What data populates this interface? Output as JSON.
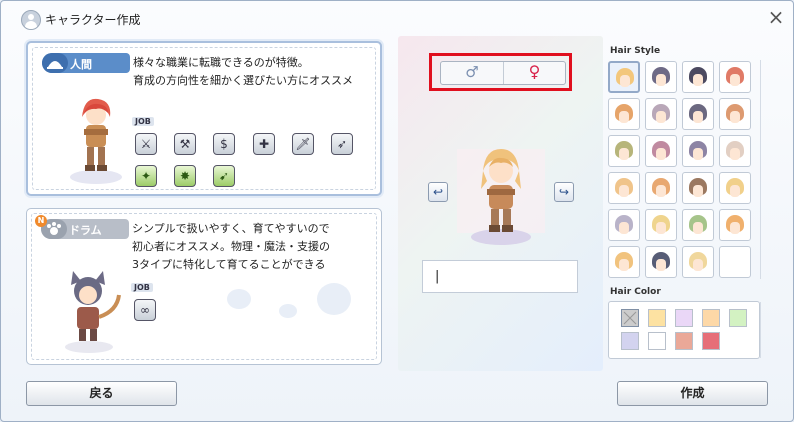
{
  "window": {
    "title": "キャラクター作成",
    "close_icon": "close-icon"
  },
  "races": [
    {
      "name": "人間",
      "selected": true,
      "description": [
        "様々な職業に転職できるのが特徴。",
        "育成の方向性を細かく選びたい方にオススメ"
      ],
      "job_label": "JOB",
      "jobs": [
        {
          "icon": "swordsman-icon",
          "glyph": "⚔"
        },
        {
          "icon": "blacksmith-icon",
          "glyph": "⚒"
        },
        {
          "icon": "merchant-icon",
          "glyph": "$"
        },
        {
          "icon": "acolyte-icon",
          "glyph": "✚"
        },
        {
          "icon": "thief-icon",
          "glyph": "🗡"
        },
        {
          "icon": "archer-icon",
          "glyph": "➶"
        },
        {
          "icon": "taekwon-icon",
          "glyph": "✦"
        },
        {
          "icon": "ninja-icon",
          "glyph": "✸"
        },
        {
          "icon": "gunslinger-icon",
          "glyph": "➹"
        }
      ]
    },
    {
      "name": "ドラム",
      "selected": false,
      "description": [
        "シンプルで扱いやすく、育てやすいので",
        "初心者にオススメ。物理・魔法・支援の",
        "3タイプに特化して育てることができる"
      ],
      "job_label": "JOB",
      "jobs": [
        {
          "icon": "summoner-icon",
          "glyph": "∞"
        }
      ]
    }
  ],
  "gender": {
    "male_symbol": "♂",
    "female_symbol": "♀",
    "selected": "female"
  },
  "rotate": {
    "left_icon": "rotate-left-arrow-icon",
    "right_icon": "rotate-right-arrow-icon",
    "left_glyph": "↩",
    "right_glyph": "↪"
  },
  "name_input": {
    "value": "|",
    "placeholder": ""
  },
  "hair_style": {
    "label": "Hair Style",
    "selected_index": 0,
    "styles": [
      "#f3c77c",
      "#6e6a86",
      "#4c4a60",
      "#e07a66",
      "#e6a469",
      "#b9a7b8",
      "#6b6880",
      "#dd9a70",
      "#b7b57a",
      "#c08aa0",
      "#8d84a4",
      "#e2cfc3",
      "#f0c48a",
      "#e8a871",
      "#9b7860",
      "#f1d08a",
      "#b9b3c9",
      "#efd48d",
      "#a6c48a",
      "#f0b06d",
      "#f1c37e",
      "#575d76",
      "#f0d79c",
      ""
    ]
  },
  "hair_color": {
    "label": "Hair Color",
    "selected_index": 0,
    "colors": [
      "#cccccc",
      "#fde2a2",
      "#ead7f7",
      "#fdd8a7",
      "#d3f2c2",
      "#d3d3ef",
      "#ffffff",
      "#eaa898",
      "#e66e78"
    ]
  },
  "buttons": {
    "back": "戻る",
    "create": "作成"
  }
}
